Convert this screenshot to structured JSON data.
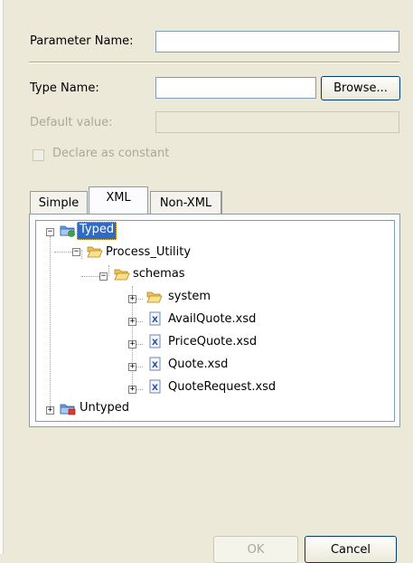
{
  "form": {
    "parameter_name_label": "Parameter Name:",
    "parameter_name_value": "",
    "type_name_label": "Type Name:",
    "type_name_value": "",
    "browse_label": "Browse...",
    "default_value_label": "Default value:",
    "default_value_value": "",
    "declare_constant_label": "Declare as constant"
  },
  "tabs": [
    {
      "label": "Simple",
      "active": false
    },
    {
      "label": "XML",
      "active": true
    },
    {
      "label": "Non-XML",
      "active": false
    }
  ],
  "tree": {
    "nodes": [
      {
        "label": "Typed",
        "icon": "typed-folder-icon",
        "selected": true,
        "expanded": true
      },
      {
        "label": "Process_Utility",
        "icon": "open-folder-icon",
        "expanded": true
      },
      {
        "label": "schemas",
        "icon": "open-folder-icon",
        "expanded": true
      },
      {
        "label": "system",
        "icon": "folder-icon",
        "expanded": false
      },
      {
        "label": "AvailQuote.xsd",
        "icon": "xsd-file-icon",
        "expanded": false
      },
      {
        "label": "PriceQuote.xsd",
        "icon": "xsd-file-icon",
        "expanded": false
      },
      {
        "label": "Quote.xsd",
        "icon": "xsd-file-icon",
        "expanded": false
      },
      {
        "label": "QuoteRequest.xsd",
        "icon": "xsd-file-icon",
        "expanded": false
      },
      {
        "label": "Untyped",
        "icon": "untyped-folder-icon",
        "expanded": false
      }
    ]
  },
  "buttons": {
    "ok_label": "OK",
    "ok_enabled": false,
    "cancel_label": "Cancel"
  },
  "colors": {
    "background": "#ece9d8",
    "selection": "#316ac5",
    "input_border": "#7f9db9"
  }
}
